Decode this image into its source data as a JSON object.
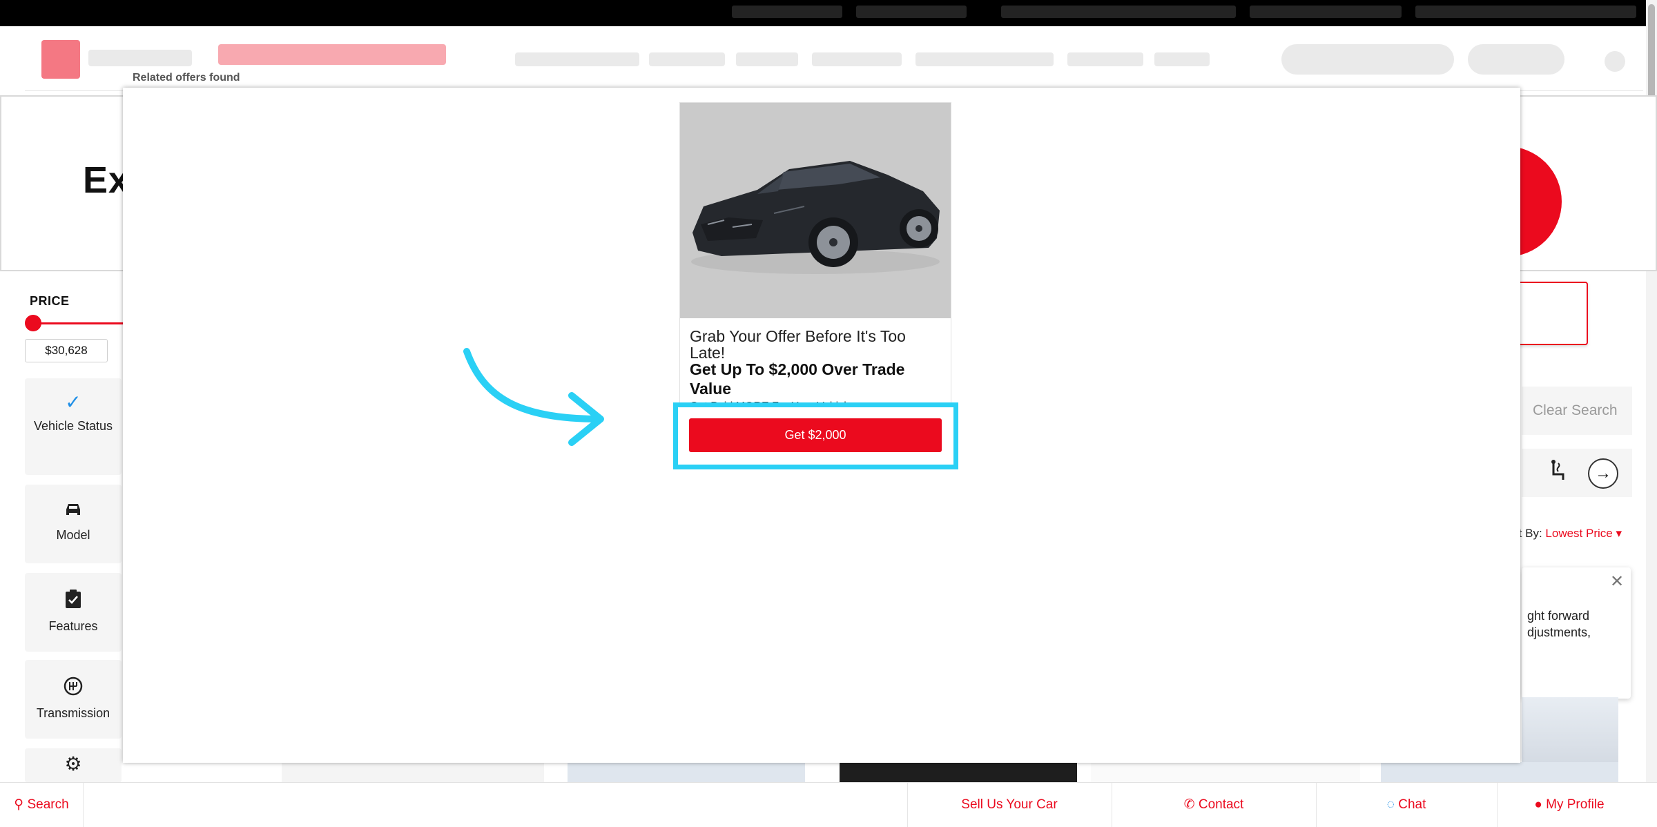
{
  "hero": {
    "text": "Ex"
  },
  "sidebar": {
    "price_label": "PRICE",
    "price_value": "$30,628",
    "filters": [
      {
        "label": "Vehicle Status",
        "icon": "checkmark-icon"
      },
      {
        "label": "Model",
        "icon": "car-icon"
      },
      {
        "label": "Features",
        "icon": "clipboard-check-icon"
      },
      {
        "label": "Transmission",
        "icon": "transmission-icon"
      }
    ]
  },
  "search": {
    "clear_label": "Clear Search"
  },
  "sort": {
    "prefix": "rt By:",
    "value": "Lowest Price"
  },
  "chat_popup": {
    "text": "ght forward djustments,"
  },
  "modal": {
    "title": "Related offers found",
    "offer": {
      "heading": "Grab Your Offer Before It's Too Late!",
      "bold": "Get Up To $2,000 Over Trade Value",
      "sub": "Get Paid MORE For Your Vehicle",
      "button_label": "Get $2,000"
    }
  },
  "bottom_nav": {
    "search": "Search",
    "sell": "Sell Us Your Car",
    "contact": "Contact",
    "chat": "Chat",
    "profile": "My Profile"
  },
  "colors": {
    "brand_red": "#eb0a1e",
    "highlight_cyan": "#2ad0f5"
  }
}
